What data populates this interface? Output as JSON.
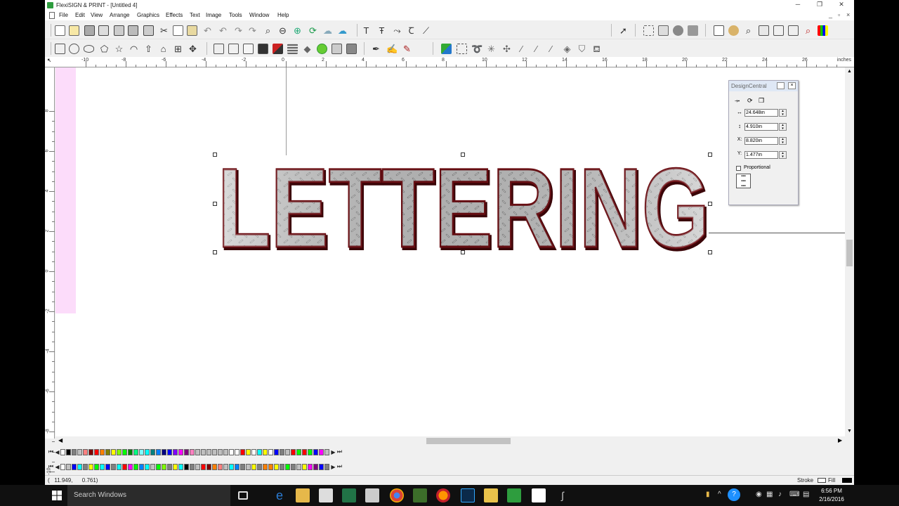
{
  "window": {
    "title": "FlexiSIGN & PRINT - [Untitled 4]",
    "minimize": "─",
    "maximize": "❐",
    "close": "✕"
  },
  "menus": [
    "File",
    "Edit",
    "View",
    "Arrange",
    "Graphics",
    "Effects",
    "Text",
    "Image",
    "Tools",
    "Window",
    "Help"
  ],
  "mdi_buttons": [
    "_",
    "▫",
    "×"
  ],
  "ruler": {
    "units": "inches",
    "h_labels": [
      "-10",
      "-8",
      "-6",
      "-4",
      "-2",
      "0",
      "2",
      "4",
      "6",
      "8",
      "10",
      "12",
      "14",
      "16",
      "18",
      "20",
      "22",
      "24",
      "26"
    ],
    "v_labels": [
      "8",
      "6",
      "4",
      "2",
      "0",
      "-2",
      "-4",
      "-6",
      "-8",
      "-10"
    ]
  },
  "artwork": {
    "text": "LETTERING",
    "fill": "diamond-plate",
    "outline_color": "#6b0d12"
  },
  "design_central": {
    "title": "DesignCentral",
    "width_label": "↔",
    "width": "24.648in",
    "height_label": "↕",
    "height": "4.910in",
    "x_label": "X:",
    "x": "8.820in",
    "y_label": "Y:",
    "y": "1.477in",
    "proportional": "Proportional"
  },
  "status": {
    "coords": "(   11.949,      0.761)",
    "stroke_label": "Stroke",
    "fill_label": "Fill"
  },
  "palette": {
    "row1": [
      "#ffffff",
      "#000000",
      "#808080",
      "#c0c0c0",
      "#ff8080",
      "#800000",
      "#ff0000",
      "#ff8000",
      "#808000",
      "#ffff00",
      "#80ff00",
      "#00ff00",
      "#008000",
      "#00ff80",
      "#80ffff",
      "#00ffff",
      "#008080",
      "#0080ff",
      "#000080",
      "#0000ff",
      "#8000ff",
      "#ff00ff",
      "#800080",
      "#ff80c0",
      "#c0c0c0",
      "#c0c0c0",
      "#c0c0c0",
      "#c0c0c0",
      "#c0c0c0",
      "#c0c0c0",
      "#ffffff",
      "#ffffff",
      "#ff0000",
      "#ffff00",
      "#ffffff",
      "#00ffff",
      "#ffff00",
      "#ffffff",
      "#0000ff",
      "#808080",
      "#c0c0c0",
      "#ff0000",
      "#00ff00",
      "#ff0000",
      "#00ff00",
      "#0000ff",
      "#ff00ff",
      "#c0c0c0"
    ],
    "row2": [
      "#ffffff",
      "#c0c0c0",
      "#0000ff",
      "#00ffff",
      "#808080",
      "#ffff00",
      "#00ff00",
      "#00ffff",
      "#0000ff",
      "#808080",
      "#00ffff",
      "#ff0000",
      "#ff00ff",
      "#00ff00",
      "#0080ff",
      "#00ffff",
      "#c0c0c0",
      "#00ff00",
      "#80ff00",
      "#808080",
      "#ffff00",
      "#00ffff",
      "#000000",
      "#808080",
      "#c0c0c0",
      "#ff0000",
      "#800000",
      "#ff8000",
      "#ff8080",
      "#c0c0c0",
      "#00ffff",
      "#0080ff",
      "#808080",
      "#c0c0c0",
      "#ffff00",
      "#808080",
      "#ff8000",
      "#ff8000",
      "#ffff00",
      "#808080",
      "#00ff00",
      "#808080",
      "#c0c0c0",
      "#ffff00",
      "#ff00ff",
      "#800080",
      "#0000ff",
      "#808080"
    ]
  },
  "taskbar": {
    "search_placeholder": "Search Windows",
    "time": "6:56 PM",
    "date": "2/16/2016"
  }
}
